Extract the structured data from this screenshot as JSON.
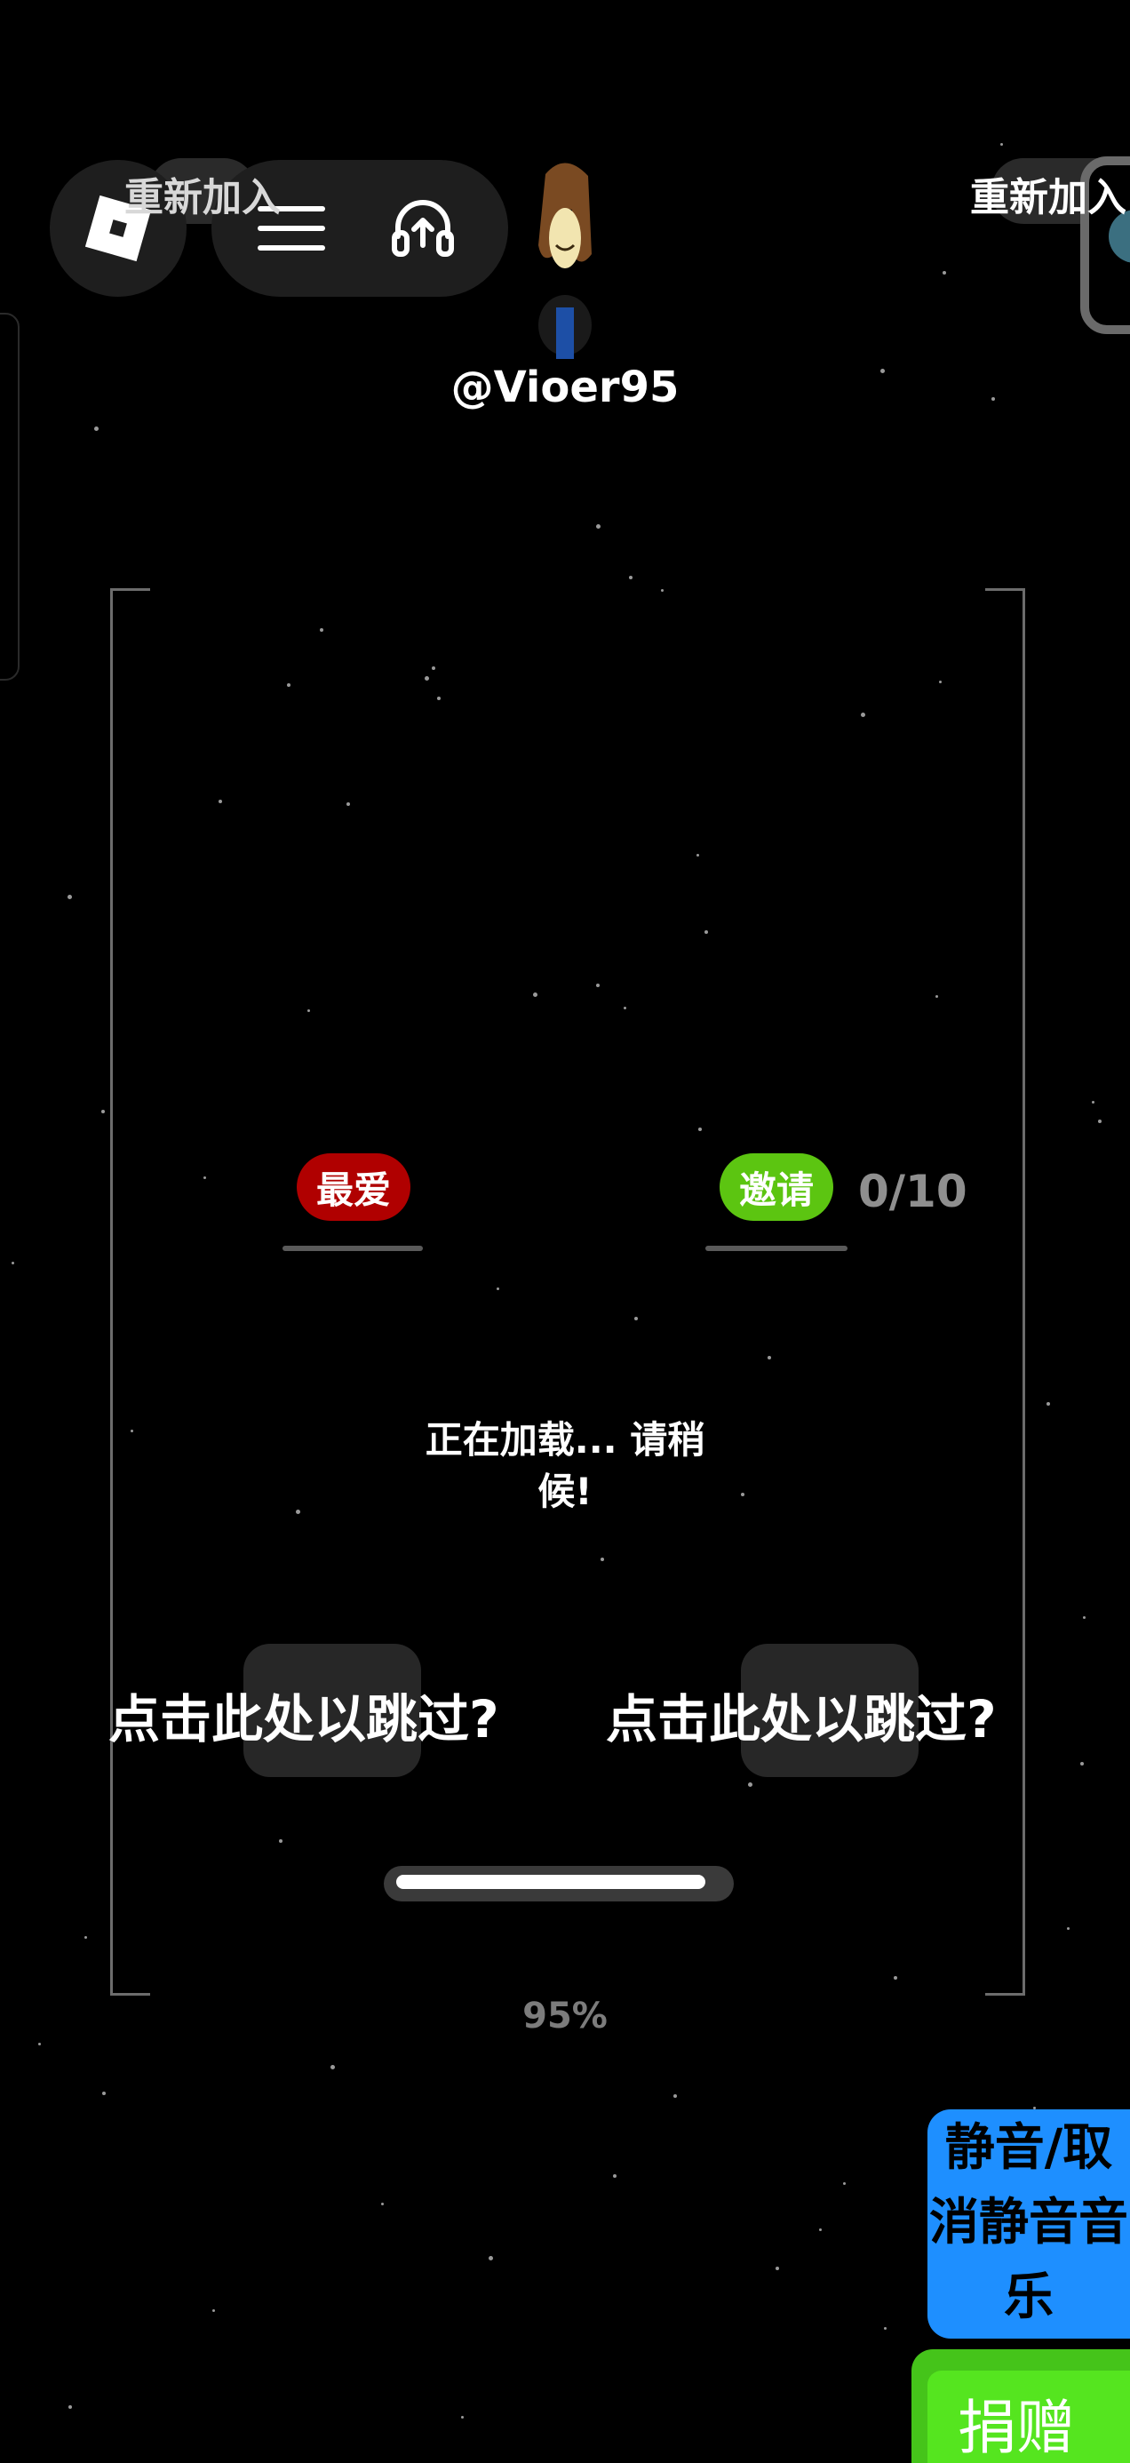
{
  "top_bar": {
    "rejoin_label": "重新加入",
    "roblox_icon": "roblox-logo-icon",
    "menu_icon": "hamburger-menu-icon",
    "voice_icon": "headset-upload-icon"
  },
  "player": {
    "username": "@Vioer95",
    "avatar": "avatar-thumbnail"
  },
  "loading_screen": {
    "favorite_label": "最爱",
    "invite_label": "邀请",
    "invite_count": "0/10",
    "loading_text": "正在加载... 请稍候!",
    "skip_label_left": "点击此处以跳过?",
    "skip_label_right": "点击此处以跳过?",
    "progress_percent": "95%",
    "progress_value": 0.95
  },
  "side_buttons": {
    "mute_label": "静音/取消静音音乐",
    "donate_label": "捐赠"
  },
  "colors": {
    "background": "#000000",
    "favorite": "#b00000",
    "invite": "#5cc511",
    "mute": "#1e8fff",
    "donate": "#55e51f"
  }
}
